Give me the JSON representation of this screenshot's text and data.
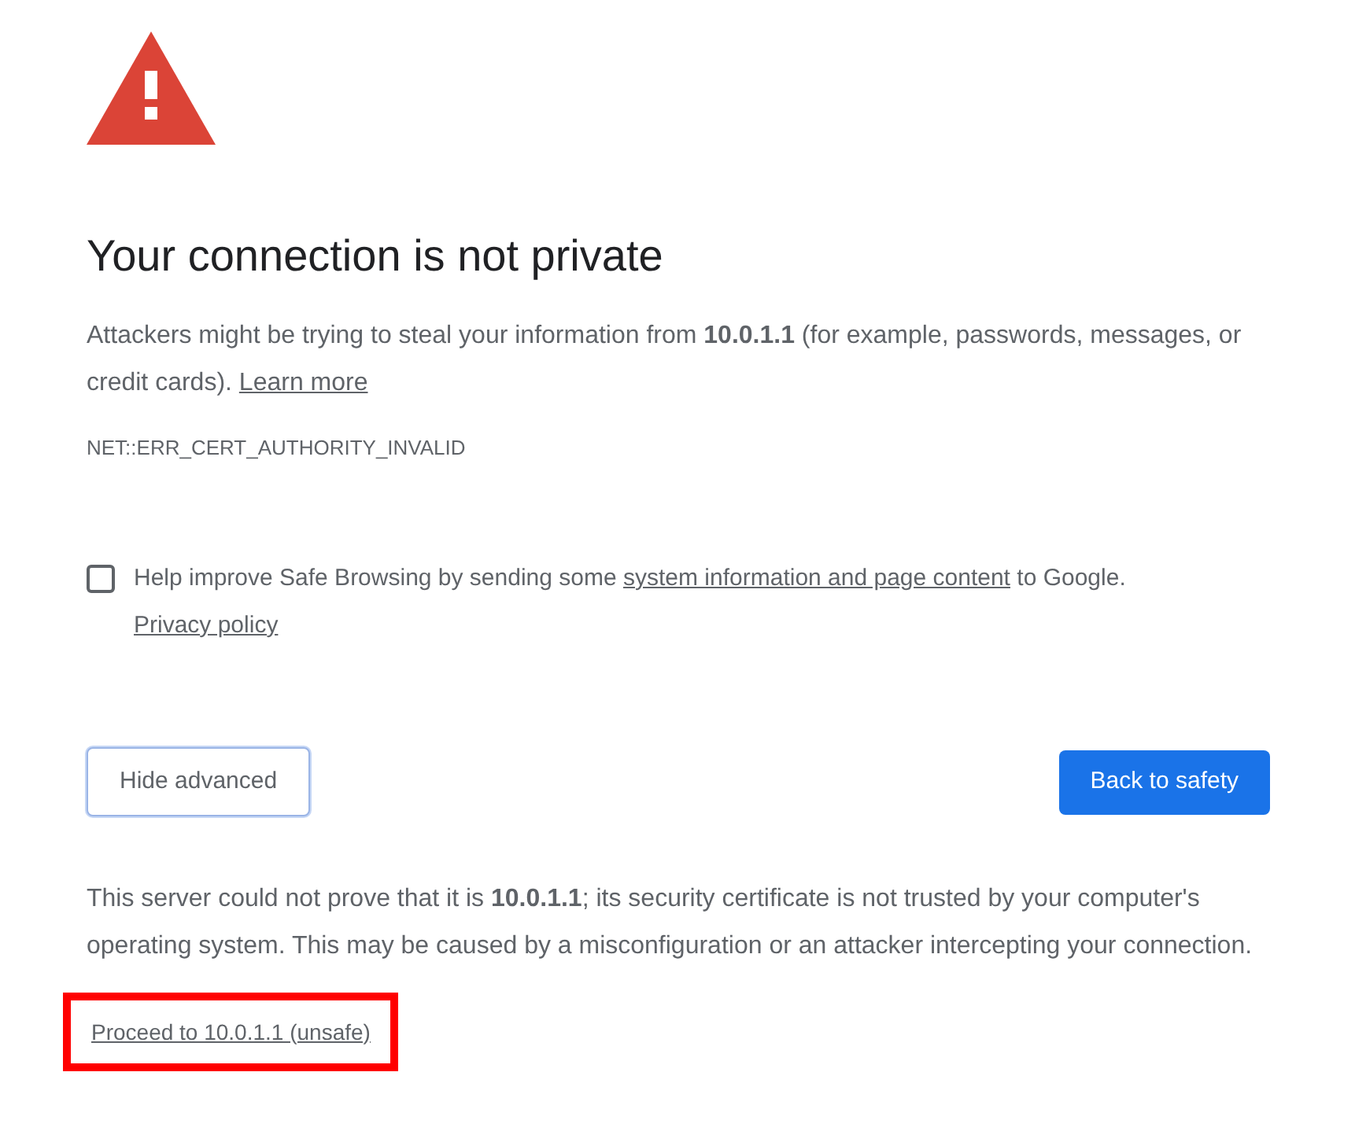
{
  "heading": "Your connection is not private",
  "intro": {
    "text": "Attackers might be trying to steal your information from **10.0.1.1** (for example, passwords, messages, or credit cards).",
    "link": "Learn more"
  },
  "error_code": "NET::ERR_CERT_AUTHORITY_INVALID",
  "safe_browsing": {
    "checked": false,
    "before": "Help improve Safe Browsing by sending some",
    "link": "system information and page content",
    "after": "to Google.",
    "privacy_link": "Privacy policy"
  },
  "buttons": [
    {
      "label": "Hide advanced",
      "kind": "secondary"
    },
    {
      "label": "Back to safety",
      "kind": "primary"
    }
  ],
  "details": "This server could not prove that it is **10.0.1.1**; its security certificate is not trusted by your computer's operating system. This may be caused by a misconfiguration or an attacker intercepting your connection.",
  "proceed_link": {
    "label": "Proceed to 10.0.1.1 (unsafe)",
    "highlighted": true
  }
}
